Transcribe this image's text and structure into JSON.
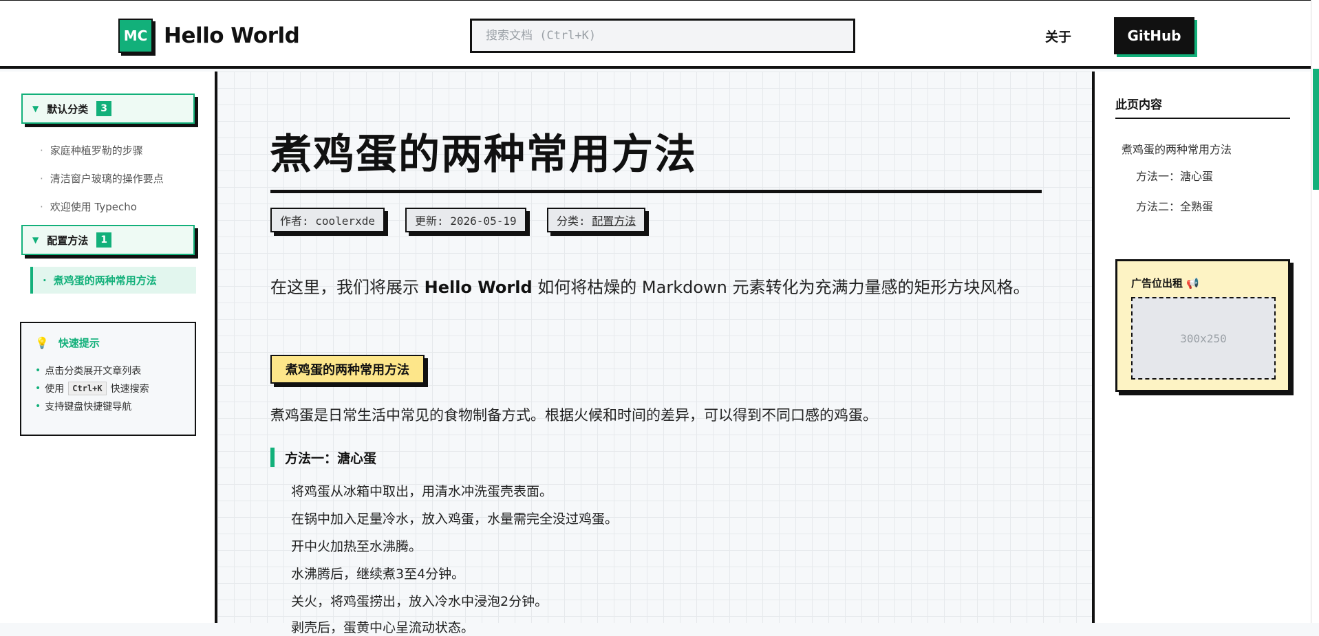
{
  "header": {
    "logo_mark": "MC",
    "site_title": "Hello World",
    "search_placeholder": "搜索文档 (Ctrl+K)",
    "nav_about": "关于",
    "nav_github": "GitHub"
  },
  "sidebar": {
    "categories": [
      {
        "label": "默认分类",
        "count": "3",
        "posts": [
          "家庭种植罗勒的步骤",
          "清洁窗户玻璃的操作要点",
          "欢迎使用 Typecho"
        ]
      },
      {
        "label": "配置方法",
        "count": "1",
        "posts": [
          "煮鸡蛋的两种常用方法"
        ]
      }
    ],
    "tips": {
      "title": "快速提示",
      "item1": "点击分类展开文章列表",
      "item2_prefix": "使用",
      "item2_key": "Ctrl+K",
      "item2_suffix": "快速搜索",
      "item3": "支持键盘快捷键导航"
    }
  },
  "article": {
    "title": "煮鸡蛋的两种常用方法",
    "meta_author": "作者: coolerxde",
    "meta_updated": "更新: 2026-05-19",
    "meta_category_prefix": "分类:",
    "meta_category": "配置方法",
    "intro_prefix": "在这里，我们将展示",
    "intro_bold": "Hello World",
    "intro_suffix": "如何将枯燥的 Markdown 元素转化为充满力量感的矩形方块风格。",
    "h2": "煮鸡蛋的两种常用方法",
    "paragraph": "煮鸡蛋是日常生活中常见的食物制备方式。根据火候和时间的差异，可以得到不同口感的鸡蛋。",
    "h3": "方法一：溏心蛋",
    "steps": [
      "将鸡蛋从冰箱中取出，用清水冲洗蛋壳表面。",
      "在锅中加入足量冷水，放入鸡蛋，水量需完全没过鸡蛋。",
      "开中火加热至水沸腾。",
      "水沸腾后，继续煮3至4分钟。",
      "关火，将鸡蛋捞出，放入冷水中浸泡2分钟。",
      "剥壳后，蛋黄中心呈流动状态。"
    ]
  },
  "toc": {
    "title": "此页内容",
    "items": [
      "煮鸡蛋的两种常用方法",
      "方法一：溏心蛋",
      "方法二：全熟蛋"
    ]
  },
  "ad": {
    "title": "广告位出租",
    "slot_label": "300x250"
  },
  "colors": {
    "accent": "#12b07a",
    "highlight": "#fde68a",
    "ad_background": "#fdf3c4"
  }
}
